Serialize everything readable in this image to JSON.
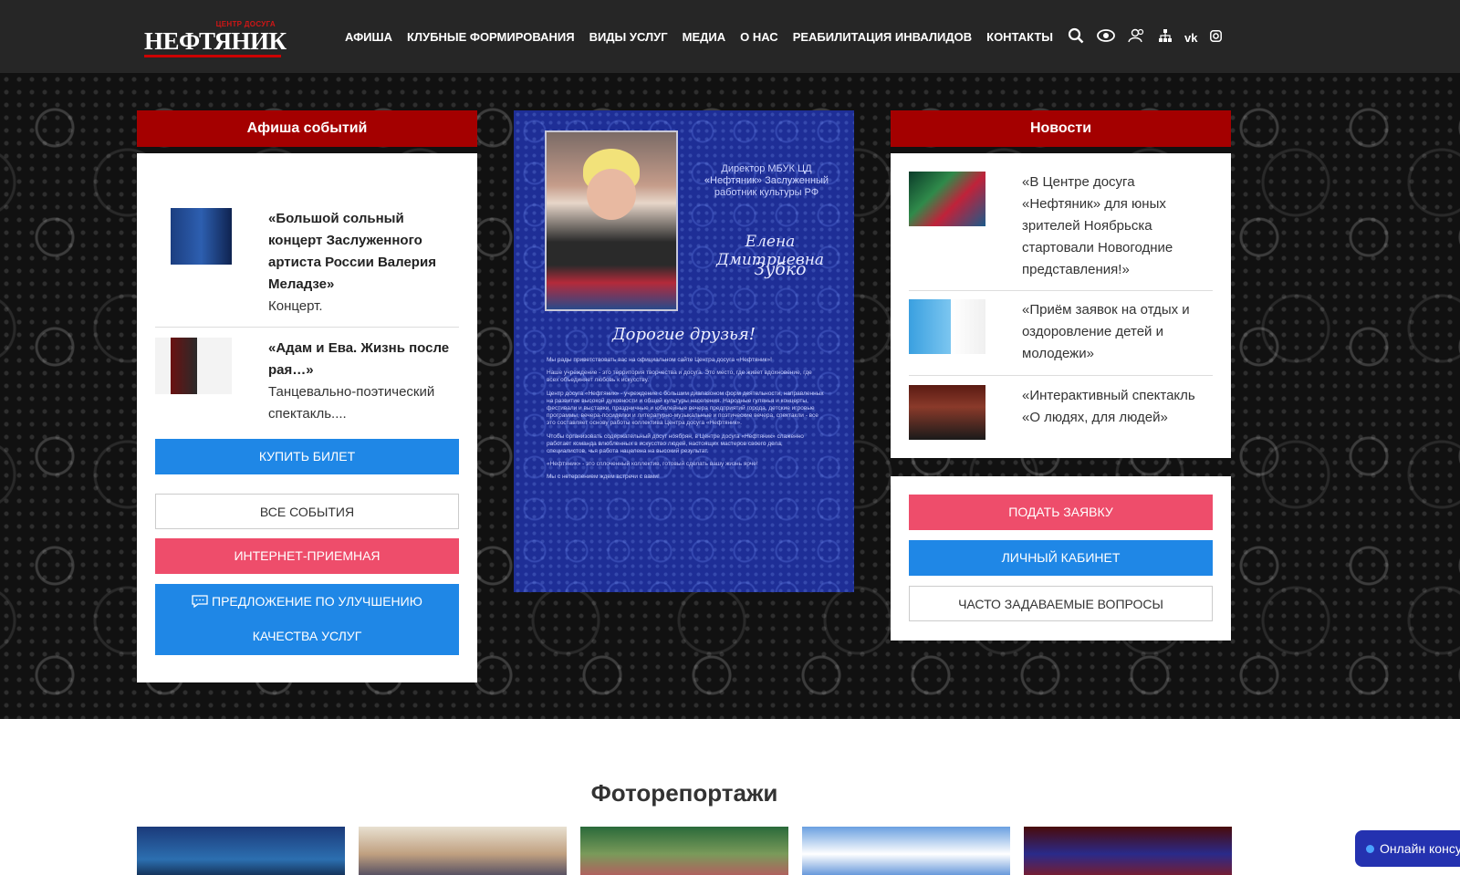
{
  "header": {
    "logo_small": "ЦЕНТР ДОСУГА",
    "logo_main": "НЕФТЯНИК",
    "nav": [
      "АФИША",
      "КЛУБНЫЕ ФОРМИРОВАНИЯ",
      "ВИДЫ УСЛУГ",
      "МЕДИА",
      "О НАС",
      "РЕАБИЛИТАЦИЯ ИНВАЛИДОВ",
      "КОНТАКТЫ"
    ],
    "icons": [
      "search-icon",
      "eye-icon",
      "users-icon",
      "sitemap-icon",
      "vk-icon",
      "instagram-icon"
    ]
  },
  "events": {
    "title": "Афиша событий",
    "items": [
      {
        "title": "«Большой сольный концерт Заслуженного артиста России Валерия Меладзе»",
        "subtitle": "Концерт."
      },
      {
        "title": "«Адам и Ева. Жизнь после рая…»",
        "subtitle": "Танцевально-поэтический спектакль...."
      }
    ],
    "buy_ticket": "КУПИТЬ БИЛЕТ",
    "all_events": "ВСЕ СОБЫТИЯ",
    "reception": "ИНТЕРНЕТ-ПРИЕМНАЯ",
    "suggestion_line1": "ПРЕДЛОЖЕНИЕ ПО УЛУЧШЕНИЮ",
    "suggestion_line2": "КАЧЕСТВА УСЛУГ"
  },
  "poster": {
    "position_text": "Директор МБУК ЦД «Нефтяник» Заслуженный работник культуры РФ",
    "name_first": "Елена Дмитриевна",
    "name_last": "Зубко",
    "greeting": "Дорогие друзья!",
    "paragraphs": [
      "Мы рады приветствовать вас на официальном сайте Центра досуга «Нефтяник»!",
      "Наше учреждение - это территория творчества и досуга. Это место, где живет вдохновение, где всех объединяет любовь к искусству.",
      "Центр досуга «Нефтяник» - учреждение с большим диапазоном форм деятельности, направленных на развитие высокой духовности и общей культуры населения. Народные гулянья и концерты, фестивали и выставки, праздничные и юбилейные вечера предприятий города, детские игровые программы, вечера-посиделки и литературно-музыкальные и поэтические вечера, спектакли - все это составляет основу работы коллектива Центра досуга «Нефтяник».",
      "Чтобы организовать содержательный досуг ноябрян, в Центре досуга «Нефтяник» слаженно работает команда влюбленных в искусство людей, настоящих мастеров своего дела, специалистов, чья работа нацелена на высокий результат.",
      "«Нефтяник» - это сплоченный коллектив, готовый сделать вашу жизнь ярче!",
      "Мы с нетерпением ждем встречи с вами!"
    ]
  },
  "news": {
    "title": "Новости",
    "items": [
      "«В Центре досуга «Нефтяник» для юных зрителей Ноябрьска стартовали Новогодние представления!»",
      "«Приём заявок на отдых и оздоровление детей и молодежи»",
      "«Интерактивный спектакль «О людях, для людей»"
    ],
    "apply": "ПОДАТЬ ЗАЯВКУ",
    "cabinet": "ЛИЧНЫЙ КАБИНЕТ",
    "faq": "ЧАСТО ЗАДАВАЕМЫЕ ВОПРОСЫ"
  },
  "photoreports": {
    "title": "Фоторепортажи"
  },
  "chat": {
    "label": "Онлайн консультант"
  },
  "colors": {
    "header_bg": "#262626",
    "panel_head": "#a40000",
    "blue_button": "#1f87e6",
    "pink_button": "#ee4d6b",
    "poster_bg": "#1e2e96"
  }
}
